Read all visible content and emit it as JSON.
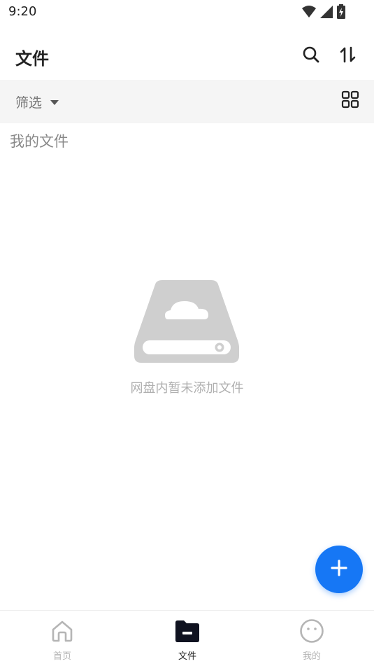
{
  "status_bar": {
    "time": "9:20",
    "icons": [
      "wifi-icon",
      "cellular-signal-icon",
      "battery-charging-icon"
    ]
  },
  "header": {
    "title": "文件",
    "actions": [
      "search-icon",
      "sort-icon"
    ]
  },
  "filter_bar": {
    "filter_label": "筛选",
    "dropdown_icon": "caret-down-icon",
    "view_toggle_icon": "grid-view-icon"
  },
  "section": {
    "title": "我的文件"
  },
  "empty_state": {
    "icon": "cloud-drive-icon",
    "message": "网盘内暂未添加文件"
  },
  "fab": {
    "icon": "plus-icon",
    "color": "#1677f5"
  },
  "bottom_nav": {
    "items": [
      {
        "label": "首页",
        "icon": "home-icon",
        "active": false
      },
      {
        "label": "文件",
        "icon": "folder-icon",
        "active": true
      },
      {
        "label": "我的",
        "icon": "face-icon",
        "active": false
      }
    ]
  },
  "colors": {
    "accent": "#1677f5",
    "filter_bar_bg": "#f5f5f5",
    "muted_text": "#b0b0b0"
  }
}
